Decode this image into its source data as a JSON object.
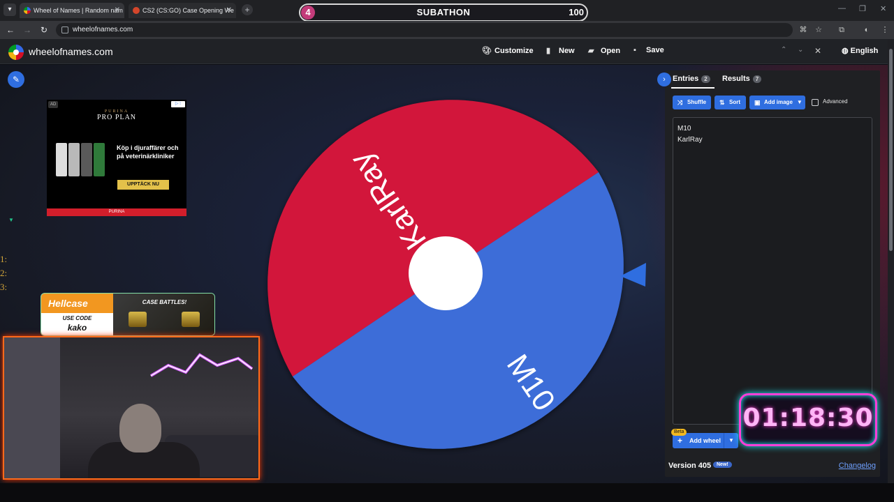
{
  "browser": {
    "tabs": [
      {
        "title": "Wheel of Names | Random nam",
        "active": true
      },
      {
        "title": "CS2 (CS:GO) Case Opening We",
        "active": false
      }
    ],
    "address": "wheelofnames.com"
  },
  "subathon": {
    "badge": "4",
    "label": "SUBATHON",
    "count": "100"
  },
  "header": {
    "site_name": "wheelofnames.com",
    "customize": "Customize",
    "new": "New",
    "open": "Open",
    "save": "Save",
    "language": "English"
  },
  "ad": {
    "tag": "AD",
    "brand": "PRO PLAN",
    "brand_top": "PURINA",
    "copy": "Köp i djuraffärer och på veterinärkliniker",
    "cta": "UPPTÄCK NU",
    "footer": "PURINA"
  },
  "overlay": {
    "leaderboard": [
      "1:",
      "2:",
      "3:"
    ],
    "hellcase_brand": "Hellcase",
    "use_code_label": "USE CODE",
    "code": "kako",
    "battles": "CASE BATTLES!",
    "timer": "01:18:30"
  },
  "wheel": {
    "segments": [
      {
        "label": "KarlRay",
        "color": "#d2173a"
      },
      {
        "label": "M10",
        "color": "#3c6dd8"
      }
    ],
    "pointer_color": "#2f6ee0"
  },
  "panel": {
    "tab_entries": "Entries",
    "entries_count": "2",
    "tab_results": "Results",
    "results_count": "7",
    "shuffle": "Shuffle",
    "sort": "Sort",
    "add_image": "Add image",
    "advanced": "Advanced",
    "entries": [
      "M10",
      "KarlRay"
    ],
    "beta": "Beta",
    "add_wheel": "Add wheel",
    "version": "Version 405",
    "new_badge": "New!",
    "changelog": "Changelog"
  }
}
